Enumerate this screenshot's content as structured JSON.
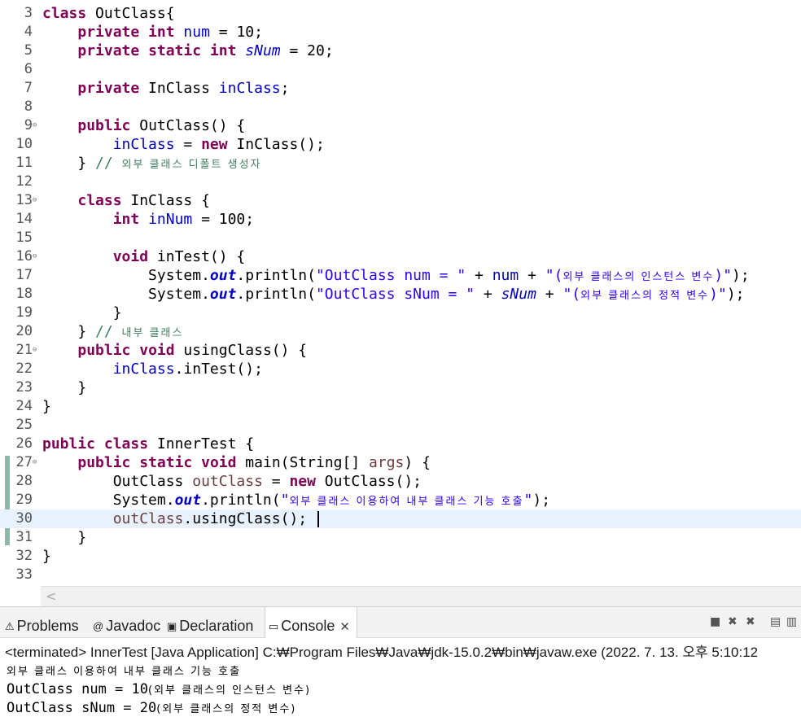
{
  "editor": {
    "lines": [
      {
        "num": "3",
        "fold": "",
        "segs": [
          [
            "k",
            "class"
          ],
          [
            "n",
            " OutClass{"
          ]
        ]
      },
      {
        "num": "4",
        "fold": "",
        "segs": [
          [
            "n",
            "    "
          ],
          [
            "k",
            "private"
          ],
          [
            "n",
            " "
          ],
          [
            "k",
            "int"
          ],
          [
            "n",
            " "
          ],
          [
            "f",
            "num"
          ],
          [
            "n",
            " = 10;"
          ]
        ]
      },
      {
        "num": "5",
        "fold": "",
        "segs": [
          [
            "n",
            "    "
          ],
          [
            "k",
            "private"
          ],
          [
            "n",
            " "
          ],
          [
            "k",
            "static"
          ],
          [
            "n",
            " "
          ],
          [
            "k",
            "int"
          ],
          [
            "n",
            " "
          ],
          [
            "sf",
            "sNum"
          ],
          [
            "n",
            " = 20;"
          ]
        ]
      },
      {
        "num": "6",
        "fold": "",
        "segs": []
      },
      {
        "num": "7",
        "fold": "",
        "segs": [
          [
            "n",
            "    "
          ],
          [
            "k",
            "private"
          ],
          [
            "n",
            " InClass "
          ],
          [
            "f",
            "inClass"
          ],
          [
            "n",
            ";"
          ]
        ]
      },
      {
        "num": "8",
        "fold": "",
        "segs": []
      },
      {
        "num": "9",
        "fold": "⊖",
        "segs": [
          [
            "n",
            "    "
          ],
          [
            "k",
            "public"
          ],
          [
            "n",
            " OutClass() {"
          ]
        ]
      },
      {
        "num": "10",
        "fold": "",
        "segs": [
          [
            "n",
            "        "
          ],
          [
            "f",
            "inClass"
          ],
          [
            "n",
            " = "
          ],
          [
            "k",
            "new"
          ],
          [
            "n",
            " InClass();"
          ]
        ]
      },
      {
        "num": "11",
        "fold": "",
        "segs": [
          [
            "n",
            "    } "
          ],
          [
            "c",
            "// "
          ],
          [
            "cko",
            "외부 클래스 디폴트 생성자"
          ]
        ]
      },
      {
        "num": "12",
        "fold": "",
        "segs": []
      },
      {
        "num": "13",
        "fold": "⊖",
        "segs": [
          [
            "n",
            "    "
          ],
          [
            "k",
            "class"
          ],
          [
            "n",
            " InClass {"
          ]
        ]
      },
      {
        "num": "14",
        "fold": "",
        "segs": [
          [
            "n",
            "        "
          ],
          [
            "k",
            "int"
          ],
          [
            "n",
            " "
          ],
          [
            "f",
            "inNum"
          ],
          [
            "n",
            " = 100;"
          ]
        ]
      },
      {
        "num": "15",
        "fold": "",
        "segs": []
      },
      {
        "num": "16",
        "fold": "⊖",
        "segs": [
          [
            "n",
            "        "
          ],
          [
            "k",
            "void"
          ],
          [
            "n",
            " inTest() {"
          ]
        ]
      },
      {
        "num": "17",
        "fold": "",
        "segs": [
          [
            "n",
            "            System."
          ],
          [
            "so",
            "out"
          ],
          [
            "n",
            ".println("
          ],
          [
            "s",
            "\"OutClass num = \""
          ],
          [
            "n",
            " + "
          ],
          [
            "f",
            "num"
          ],
          [
            "n",
            " + "
          ],
          [
            "s",
            "\"("
          ],
          [
            "sko",
            "외부 클래스의 인스턴스 변수"
          ],
          [
            "s",
            ")\""
          ],
          [
            "n",
            ");"
          ]
        ]
      },
      {
        "num": "18",
        "fold": "",
        "segs": [
          [
            "n",
            "            System."
          ],
          [
            "so",
            "out"
          ],
          [
            "n",
            ".println("
          ],
          [
            "s",
            "\"OutClass sNum = \""
          ],
          [
            "n",
            " + "
          ],
          [
            "sf",
            "sNum"
          ],
          [
            "n",
            " + "
          ],
          [
            "s",
            "\"("
          ],
          [
            "sko",
            "외부 클래스의 정적 변수"
          ],
          [
            "s",
            ")\""
          ],
          [
            "n",
            ");"
          ]
        ]
      },
      {
        "num": "19",
        "fold": "",
        "segs": [
          [
            "n",
            "        }"
          ]
        ]
      },
      {
        "num": "20",
        "fold": "",
        "segs": [
          [
            "n",
            "    } "
          ],
          [
            "c",
            "// "
          ],
          [
            "cko",
            "내부 클래스"
          ]
        ]
      },
      {
        "num": "21",
        "fold": "⊖",
        "segs": [
          [
            "n",
            "    "
          ],
          [
            "k",
            "public"
          ],
          [
            "n",
            " "
          ],
          [
            "k",
            "void"
          ],
          [
            "n",
            " usingClass() {"
          ]
        ]
      },
      {
        "num": "22",
        "fold": "",
        "segs": [
          [
            "n",
            "        "
          ],
          [
            "f",
            "inClass"
          ],
          [
            "n",
            ".inTest();"
          ]
        ]
      },
      {
        "num": "23",
        "fold": "",
        "segs": [
          [
            "n",
            "    }"
          ]
        ]
      },
      {
        "num": "24",
        "fold": "",
        "segs": [
          [
            "n",
            "}"
          ]
        ]
      },
      {
        "num": "25",
        "fold": "",
        "segs": []
      },
      {
        "num": "26",
        "fold": "",
        "segs": [
          [
            "k",
            "public"
          ],
          [
            "n",
            " "
          ],
          [
            "k",
            "class"
          ],
          [
            "n",
            " InnerTest {"
          ]
        ]
      },
      {
        "num": "27",
        "fold": "⊖",
        "segs": [
          [
            "n",
            "    "
          ],
          [
            "k",
            "public"
          ],
          [
            "n",
            " "
          ],
          [
            "k",
            "static"
          ],
          [
            "n",
            " "
          ],
          [
            "k",
            "void"
          ],
          [
            "n",
            " main(String[] "
          ],
          [
            "lv",
            "args"
          ],
          [
            "n",
            ") {"
          ]
        ]
      },
      {
        "num": "28",
        "fold": "",
        "segs": [
          [
            "n",
            "        OutClass "
          ],
          [
            "lv",
            "outClass"
          ],
          [
            "n",
            " = "
          ],
          [
            "k",
            "new"
          ],
          [
            "n",
            " OutClass();"
          ]
        ]
      },
      {
        "num": "29",
        "fold": "",
        "segs": [
          [
            "n",
            "        System."
          ],
          [
            "so",
            "out"
          ],
          [
            "n",
            ".println("
          ],
          [
            "s",
            "\""
          ],
          [
            "sko",
            "외부 클래스 이용하여 내부 클래스 기능 호출"
          ],
          [
            "s",
            "\""
          ],
          [
            "n",
            ");"
          ]
        ]
      },
      {
        "num": "30",
        "fold": "",
        "current": true,
        "caret": true,
        "segs": [
          [
            "n",
            "        "
          ],
          [
            "lv",
            "outClass"
          ],
          [
            "n",
            ".usingClass(); "
          ]
        ]
      },
      {
        "num": "31",
        "fold": "",
        "segs": [
          [
            "n",
            "    }"
          ]
        ]
      },
      {
        "num": "32",
        "fold": "",
        "segs": [
          [
            "n",
            "}"
          ]
        ]
      },
      {
        "num": "33",
        "fold": "",
        "segs": []
      }
    ]
  },
  "scroll": {
    "left_arrow": "<"
  },
  "views": {
    "tabs": [
      {
        "name": "tab-problems",
        "icon": "problems-icon",
        "glyph": "⚠",
        "label": "Problems",
        "active": false
      },
      {
        "name": "tab-javadoc",
        "icon": "javadoc-icon",
        "glyph": "@",
        "label": "Javadoc",
        "active": false
      },
      {
        "name": "tab-declaration",
        "icon": "declaration-icon",
        "glyph": "▣",
        "label": "Declaration",
        "active": false
      },
      {
        "name": "tab-console",
        "icon": "console-icon",
        "glyph": "▭",
        "label": "Console",
        "active": true
      }
    ],
    "close_glyph": "✕"
  },
  "console": {
    "status": "<terminated> InnerTest [Java Application] C:₩Program Files₩Java₩jdk-15.0.2₩bin₩javaw.exe  (2022. 7. 13. 오후 5:10:12",
    "output": [
      "외부 클래스 이용하여 내부 클래스 기능 호출",
      "OutClass num = 10(외부 클래스의 인스턴스 변수)",
      "OutClass sNum = 20(외부 클래스의 정적 변수)"
    ]
  },
  "toolbar": {
    "terminate": "■",
    "remove": "✖",
    "remove_all": "✖",
    "scroll_lock": "▤",
    "word_wrap": "▥"
  }
}
